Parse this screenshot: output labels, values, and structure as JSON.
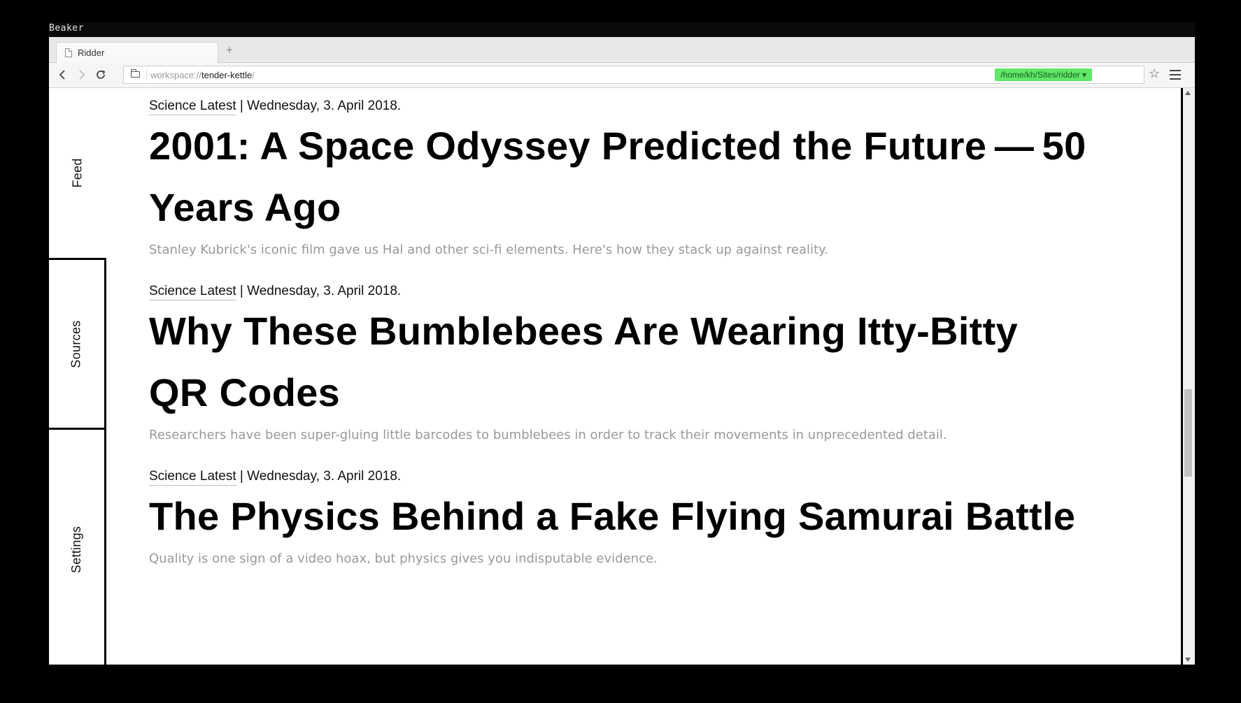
{
  "os": {
    "app_name": "Beaker"
  },
  "browser": {
    "tab": {
      "title": "Ridder"
    },
    "new_tab_label": "+",
    "url": {
      "scheme": "workspace://",
      "host": "tender-kettle",
      "trailing": "/"
    },
    "path_badge": "/home/kh/Sites/ridder ▾",
    "icons": {
      "back": "back-arrow-icon",
      "forward": "forward-arrow-icon",
      "reload": "reload-icon",
      "folder": "folder-icon",
      "bolt": "bolt-icon",
      "star": "star-icon",
      "menu": "hamburger-menu-icon"
    }
  },
  "sidebar": {
    "items": [
      {
        "label": "Feed"
      },
      {
        "label": "Sources"
      },
      {
        "label": "Settings"
      }
    ]
  },
  "feed": {
    "articles": [
      {
        "source": "Science Latest",
        "date": " | Wednesday, 3. April 2018.",
        "title": "2001: A Space Odyssey Predicted the Future — 50 Years Ago",
        "summary": "Stanley Kubrick's iconic film gave us Hal and other sci-fi elements. Here's how they stack up against reality."
      },
      {
        "source": "Science Latest",
        "date": " | Wednesday, 3. April 2018.",
        "title": "Why These Bumblebees Are Wearing Itty-Bitty QR Codes",
        "summary": "Researchers have been super-gluing little barcodes to bumblebees in order to track their movements in unprecedented detail."
      },
      {
        "source": "Science Latest",
        "date": " | Wednesday, 3. April 2018.",
        "title": "The Physics Behind a Fake Flying Samurai Battle",
        "summary": "Quality is one sign of a video hoax, but physics gives you indisputable evidence."
      }
    ]
  },
  "colors": {
    "path_badge_bg": "#5ee866",
    "summary_text": "#999999",
    "headline_text": "#000000"
  }
}
